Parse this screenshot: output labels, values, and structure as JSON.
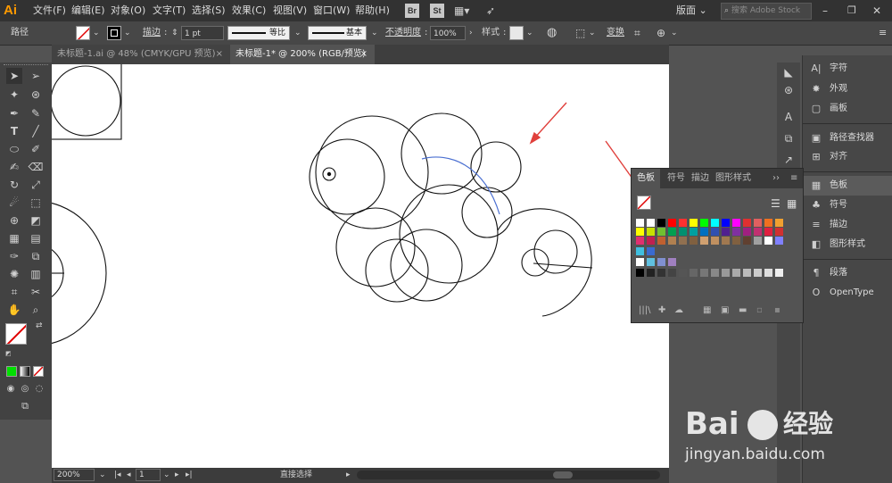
{
  "app": {
    "logo": "Ai"
  },
  "menu": {
    "items": [
      "文件(F)",
      "编辑(E)",
      "对象(O)",
      "文字(T)",
      "选择(S)",
      "效果(C)",
      "视图(V)",
      "窗口(W)",
      "帮助(H)"
    ],
    "bridge": "Br",
    "stock": "St",
    "workspace": "版面",
    "search_placeholder": "搜索 Adobe Stock"
  },
  "control": {
    "selection_label": "路径",
    "stroke_label": "描边",
    "stroke_value": "1 pt",
    "profile_label": "等比",
    "brush_label": "基本",
    "opacity_label": "不透明度",
    "opacity_value": "100%",
    "style_label": "样式",
    "transform_label": "变换"
  },
  "tabs": [
    {
      "label": "未标题-1.ai @ 48% (CMYK/GPU 预览)",
      "close": "×",
      "active": false
    },
    {
      "label": "未标题-1* @ 200% (RGB/预览)",
      "close": "×",
      "active": true
    }
  ],
  "status": {
    "zoom": "200%",
    "artboard": "1",
    "tool": "直接选择"
  },
  "swatches_panel": {
    "tabs": [
      "色板",
      "符号",
      "描边",
      "图形样式"
    ],
    "active_tab": "色板",
    "rows": [
      [
        "#ffffff",
        "#ffffff",
        "#000000",
        "#ff0000",
        "#ff3030",
        "#ffff00",
        "#00ff00",
        "#00ffff",
        "#0000ff",
        "#ff00ff",
        "#e03030",
        "#e06060",
        "#f07020",
        "#f0a030"
      ],
      [
        "#ffff00",
        "#c8e000",
        "#70c030",
        "#00a050",
        "#009070",
        "#00a0a0",
        "#0070c0",
        "#3050b0",
        "#502090",
        "#8030a0",
        "#a02080",
        "#c03070",
        "#e02040",
        "#d03030"
      ],
      [
        "#e03070",
        "#c02050",
        "#c06030",
        "#b08050",
        "#907050",
        "#806040",
        "#d0a070",
        "#c09060",
        "#a07850",
        "#806040",
        "#604030",
        "#a0a0a0",
        "#ffffff",
        "#8080ff"
      ],
      [
        "#40c0e0",
        "#3a6ad0"
      ],
      [
        "#ffffff",
        "#60c0e0",
        "#8090d0",
        "#a080c0"
      ],
      [
        "#000000",
        "#222222",
        "#333333",
        "#444444",
        "#555555",
        "#666666",
        "#777777",
        "#888888",
        "#999999",
        "#aaaaaa",
        "#bbbbbb",
        "#cccccc",
        "#dddddd",
        "#eeeeee"
      ]
    ]
  },
  "panels": [
    {
      "icon": "A|",
      "label": "字符"
    },
    {
      "icon": "✸",
      "label": "外观"
    },
    {
      "icon": "▢",
      "label": "画板"
    },
    {
      "icon": "▣",
      "label": "路径查找器"
    },
    {
      "icon": "⊞",
      "label": "对齐"
    },
    {
      "icon": "▦",
      "label": "色板"
    },
    {
      "icon": "♣",
      "label": "符号"
    },
    {
      "icon": "≡",
      "label": "描边"
    },
    {
      "icon": "◧",
      "label": "图形样式"
    },
    {
      "icon": "¶",
      "label": "段落"
    },
    {
      "icon": "O",
      "label": "OpenType"
    }
  ],
  "watermark": {
    "brand": "Bai",
    "brand2": "经验",
    "url": "jingyan.baidu.com"
  }
}
